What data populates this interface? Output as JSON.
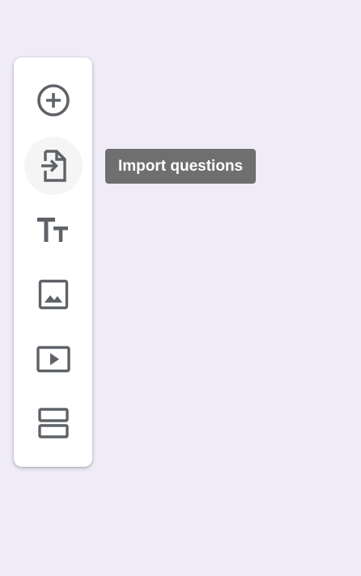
{
  "colors": {
    "background": "#efebf7",
    "toolbar_bg": "#ffffff",
    "icon_color": "#5f6368",
    "hover_bg": "#f5f5f6",
    "tooltip_bg": "#6f6f6f",
    "tooltip_text": "#ffffff"
  },
  "toolbar": {
    "items": [
      {
        "icon": "add-circle-icon",
        "state": "default"
      },
      {
        "icon": "import-file-icon",
        "state": "hovered"
      },
      {
        "icon": "title-text-icon",
        "state": "default"
      },
      {
        "icon": "image-icon",
        "state": "default"
      },
      {
        "icon": "video-play-icon",
        "state": "default"
      },
      {
        "icon": "section-icon",
        "state": "default"
      }
    ]
  },
  "tooltip": {
    "text": "Import questions"
  }
}
